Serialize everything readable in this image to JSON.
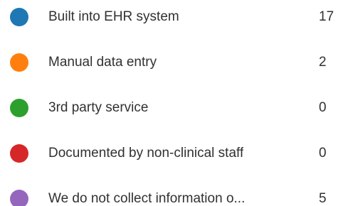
{
  "legend": {
    "items": [
      {
        "label": "Built into EHR system",
        "count": "17",
        "color": "#1f77b4"
      },
      {
        "label": "Manual data entry",
        "count": "2",
        "color": "#ff7f0e"
      },
      {
        "label": "3rd party service",
        "count": "0",
        "color": "#2ca02c"
      },
      {
        "label": "Documented by non-clinical staff",
        "count": "0",
        "color": "#d62728"
      },
      {
        "label": "We do not collect information o...",
        "count": "5",
        "color": "#9467bd"
      }
    ]
  }
}
